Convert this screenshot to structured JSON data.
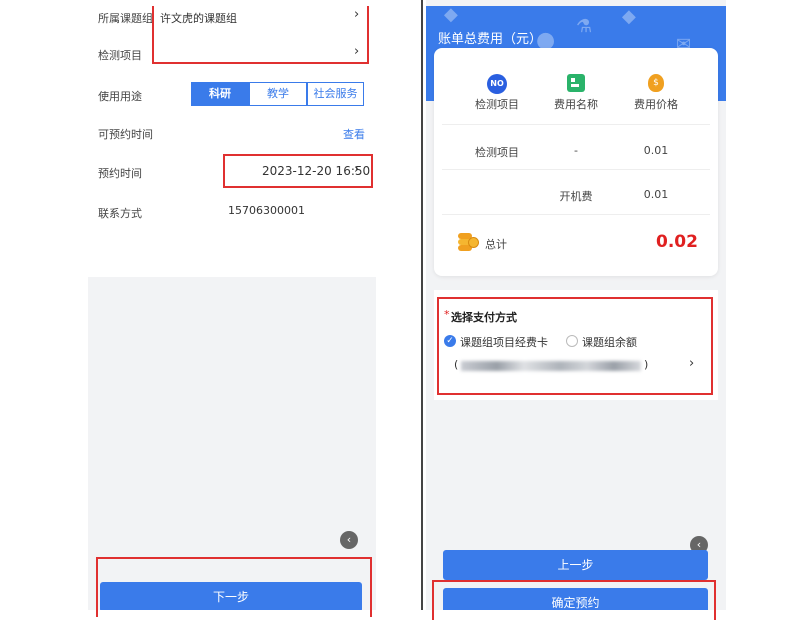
{
  "left": {
    "group_label": "所属课题组",
    "group_value": "许文虎的课题组",
    "item_label": "检测项目",
    "usage_label": "使用用途",
    "usage_options": [
      "科研",
      "教学",
      "社会服务"
    ],
    "bookable_label": "可预约时间",
    "bookable_link": "查看",
    "appoint_label": "预约时间",
    "appoint_value": "2023-12-20 16:50",
    "contact_label": "联系方式",
    "contact_value": "15706300001",
    "back_glyph": "‹",
    "next_button": "下一步"
  },
  "right": {
    "header_title": "账单总费用（元）",
    "columns": [
      {
        "icon_text": "NO",
        "label": "检测项目"
      },
      {
        "icon_text": "",
        "label": "费用名称"
      },
      {
        "icon_text": "",
        "label": "费用价格"
      }
    ],
    "rows": [
      [
        "检测项目",
        "-",
        "0.01"
      ],
      [
        "",
        "开机费",
        "0.01"
      ]
    ],
    "total_label": "总计",
    "total_value": "0.02",
    "pay_required_mark": "*",
    "pay_title": "选择支付方式",
    "pay_option_1": "课题组项目经费卡",
    "pay_option_2": "课题组余额",
    "pay_account_prefix": "(",
    "pay_account_suffix": ")",
    "back_glyph": "‹",
    "prev_button": "上一步",
    "confirm_button": "确定预约"
  },
  "colors": {
    "primary": "#3a7bea",
    "highlight_border": "#e03030",
    "total_red": "#e02020",
    "badge_blue": "#2a5fe0",
    "badge_green": "#2ab36a",
    "badge_gold": "#f0a020"
  }
}
